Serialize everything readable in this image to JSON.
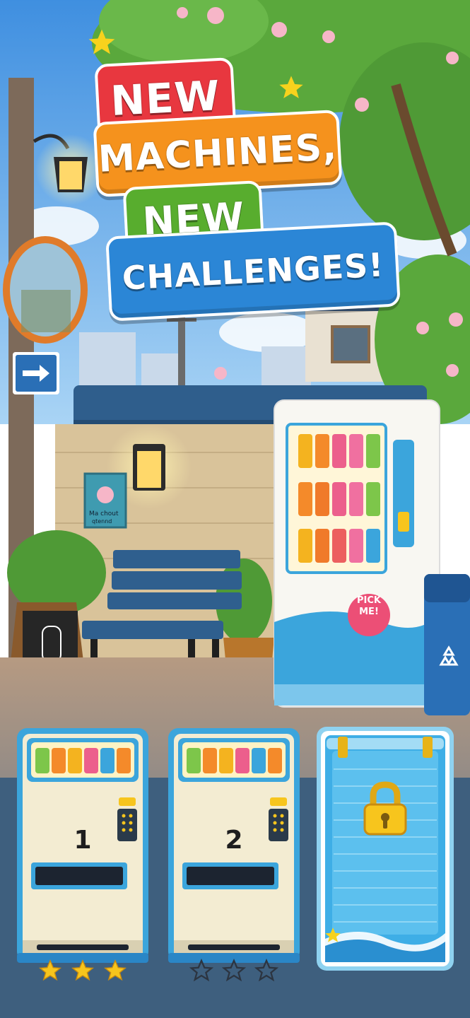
{
  "title": {
    "line1": "NEW",
    "line2": "MACHINES,",
    "line3": "NEW",
    "line4": "CHALLENGES!"
  },
  "scene": {
    "sign_text": "Ma chout",
    "sign_subtext": "qtennd",
    "vending_sticker": "PICK ME!"
  },
  "levels": [
    {
      "number": "1",
      "locked": false,
      "stars_earned": 3,
      "stars_total": 3
    },
    {
      "number": "2",
      "locked": false,
      "stars_earned": 0,
      "stars_total": 3
    },
    {
      "number": "",
      "locked": true,
      "stars_earned": 0,
      "stars_total": 0
    }
  ],
  "colors": {
    "sky": "#5fa8e8",
    "banner_red": "#e8373f",
    "banner_orange": "#f5921d",
    "banner_green": "#58ad2e",
    "banner_blue": "#2b86d6",
    "machine_cream": "#f3ecd2",
    "machine_blue": "#3ba5dc",
    "star_gold": "#f7c51d"
  },
  "icons": [
    "arrow-right-sign-icon",
    "lock-icon",
    "star-icon",
    "recycle-icon"
  ]
}
